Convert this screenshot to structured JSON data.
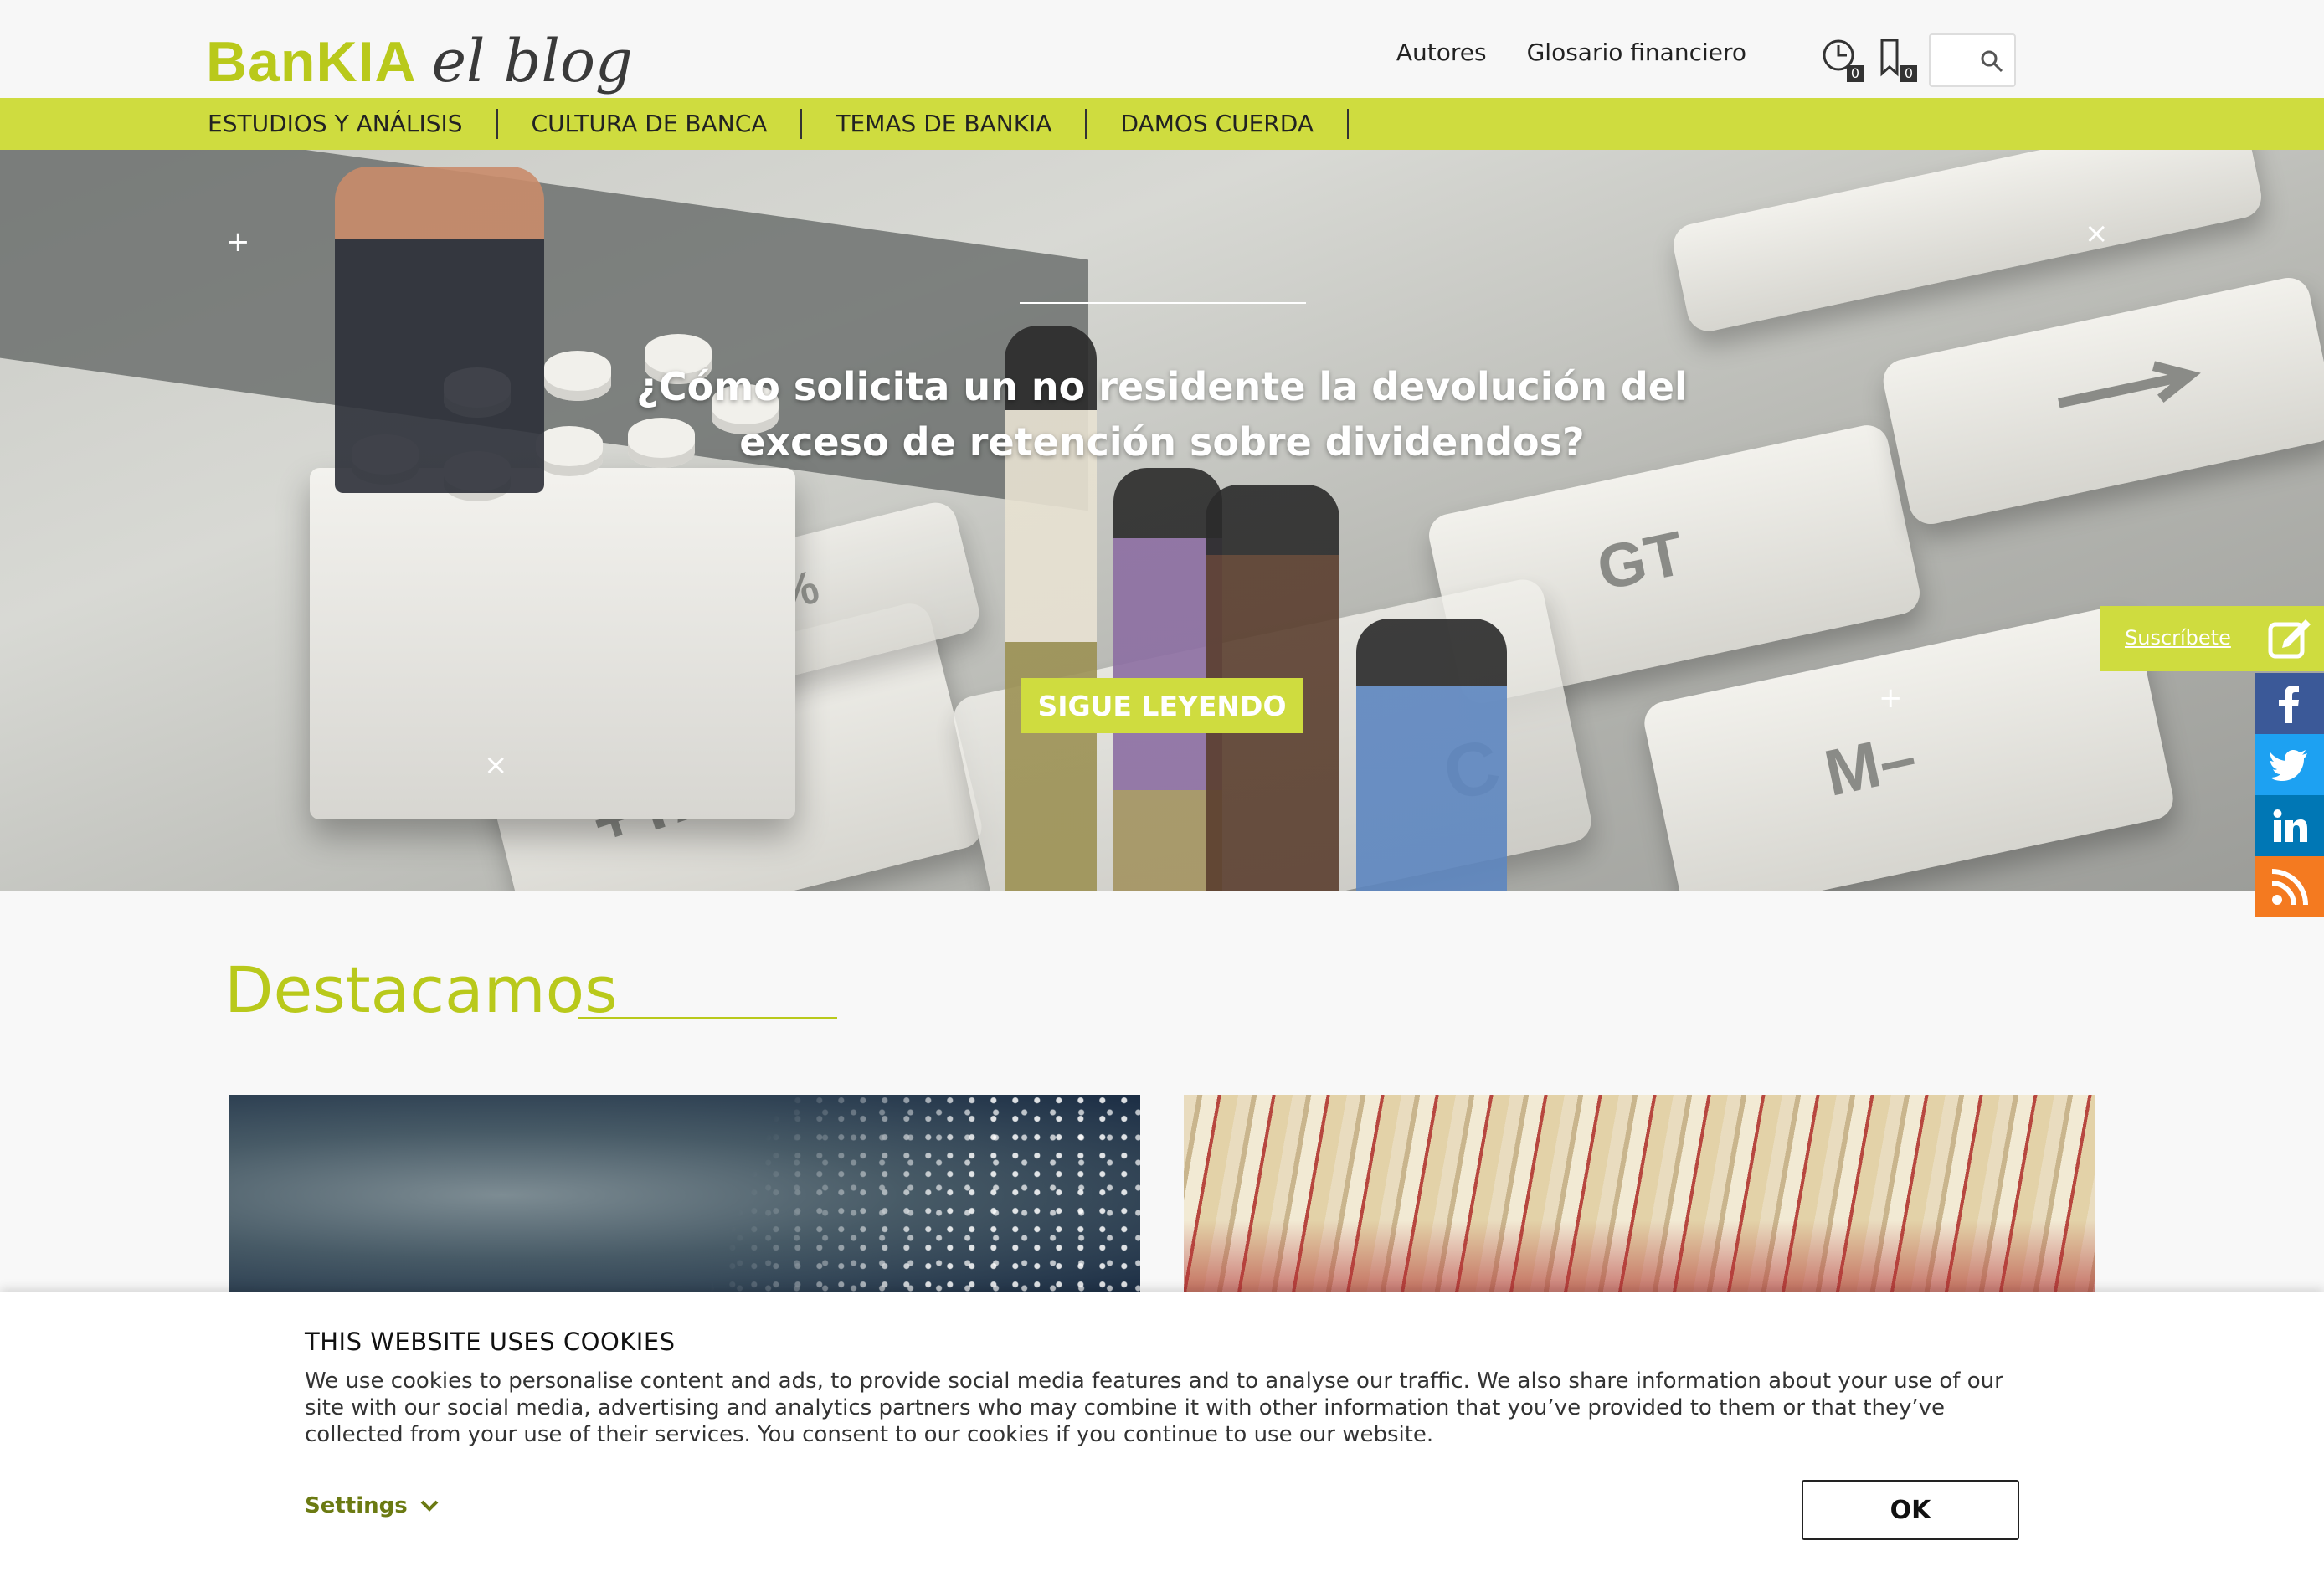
{
  "brand": {
    "logo_main": "BanKIA",
    "logo_blog": "el blog",
    "accent_color": "#cfdc3f",
    "logo_color": "#b9c91b"
  },
  "header": {
    "links": [
      "Autores",
      "Glosario financiero"
    ],
    "history_count": "0",
    "bookmarks_count": "0",
    "search_placeholder": ""
  },
  "nav": {
    "items": [
      "ESTUDIOS Y ANÁLISIS",
      "CULTURA DE BANCA",
      "TEMAS DE BANKIA",
      "DAMOS CUERDA"
    ]
  },
  "hero": {
    "title": "¿Cómo solicita un no residente la devolución del exceso de retención sobre dividendos?",
    "button_label": "SIGUE LEYENDO",
    "key_labels": [
      "+TAX",
      "GT",
      "M–",
      "%",
      "C"
    ]
  },
  "sidebar": {
    "subscribe_label": "Suscríbete",
    "social": [
      {
        "name": "facebook",
        "color": "#3b5998"
      },
      {
        "name": "twitter",
        "color": "#1da1f2"
      },
      {
        "name": "linkedin",
        "color": "#0077b5"
      },
      {
        "name": "rss",
        "color": "#f47a20"
      }
    ]
  },
  "featured": {
    "title": "Destacamos"
  },
  "cookie": {
    "title": "THIS WEBSITE USES COOKIES",
    "text": "We use cookies to personalise content and ads, to provide social media features and to analyse our traffic. We also share information about your use of our site with our social media, advertising and analytics partners who may combine it with other information that you’ve provided to them or that they’ve collected from your use of their services. You consent to our cookies if you continue to use our website.",
    "settings_label": "Settings",
    "ok_label": "OK"
  }
}
